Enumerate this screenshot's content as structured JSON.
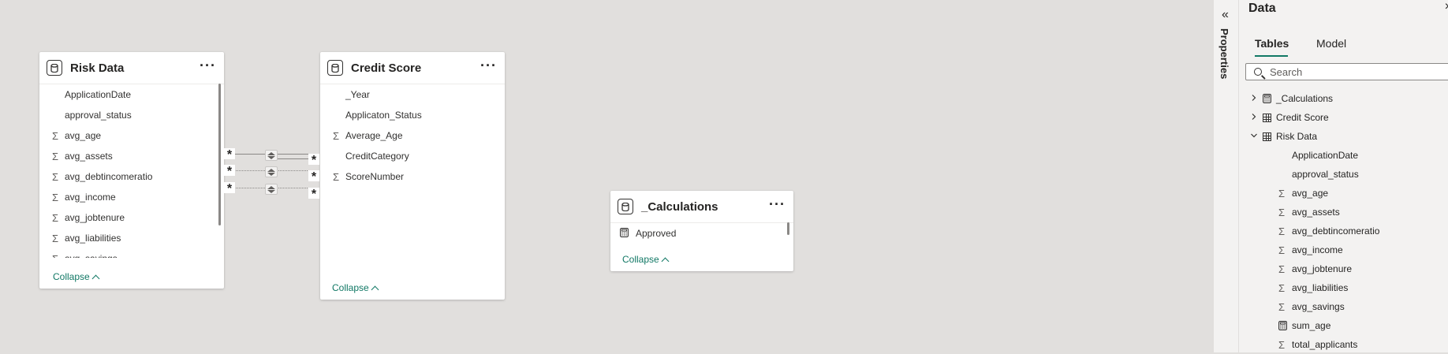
{
  "canvas": {
    "tables": [
      {
        "key": "risk",
        "title": "Risk Data",
        "fields": [
          {
            "label": "ApplicationDate",
            "sigma": false
          },
          {
            "label": "approval_status",
            "sigma": false
          },
          {
            "label": "avg_age",
            "sigma": true
          },
          {
            "label": "avg_assets",
            "sigma": true
          },
          {
            "label": "avg_debtincomeratio",
            "sigma": true
          },
          {
            "label": "avg_income",
            "sigma": true
          },
          {
            "label": "avg_jobtenure",
            "sigma": true
          },
          {
            "label": "avg_liabilities",
            "sigma": true
          },
          {
            "label": "avg_savings",
            "sigma": true
          }
        ],
        "collapse_label": "Collapse"
      },
      {
        "key": "credit",
        "title": "Credit Score",
        "fields": [
          {
            "label": "_Year",
            "sigma": false
          },
          {
            "label": "Applicaton_Status",
            "sigma": false
          },
          {
            "label": "Average_Age",
            "sigma": true
          },
          {
            "label": "CreditCategory",
            "sigma": false
          },
          {
            "label": "ScoreNumber",
            "sigma": true
          }
        ],
        "collapse_label": "Collapse"
      },
      {
        "key": "calc",
        "title": "_Calculations",
        "fields": [
          {
            "label": "Approved",
            "calc": true
          }
        ],
        "collapse_label": "Collapse"
      }
    ],
    "relationship_symbol": "*",
    "more_symbol": "···",
    "sigma_symbol": "Σ"
  },
  "properties_panel": {
    "label": "Properties",
    "expand_icon": "«"
  },
  "data_pane": {
    "title": "Data",
    "close_icon": "×",
    "tabs": [
      "Tables",
      "Model"
    ],
    "active_tab": "Tables",
    "search": {
      "placeholder": "Search",
      "value": ""
    },
    "tree": [
      {
        "label": "_Calculations",
        "icon": "calc",
        "expand": "collapsed",
        "level": 0
      },
      {
        "label": "Credit Score",
        "icon": "table",
        "expand": "collapsed",
        "level": 0
      },
      {
        "label": "Risk Data",
        "icon": "table",
        "expand": "expanded",
        "level": 0
      },
      {
        "label": "ApplicationDate",
        "icon": "none",
        "level": 1
      },
      {
        "label": "approval_status",
        "icon": "none",
        "level": 1
      },
      {
        "label": "avg_age",
        "icon": "sigma",
        "level": 1
      },
      {
        "label": "avg_assets",
        "icon": "sigma",
        "level": 1
      },
      {
        "label": "avg_debtincomeratio",
        "icon": "sigma",
        "level": 1
      },
      {
        "label": "avg_income",
        "icon": "sigma",
        "level": 1
      },
      {
        "label": "avg_jobtenure",
        "icon": "sigma",
        "level": 1
      },
      {
        "label": "avg_liabilities",
        "icon": "sigma",
        "level": 1
      },
      {
        "label": "avg_savings",
        "icon": "sigma",
        "level": 1
      },
      {
        "label": "sum_age",
        "icon": "calc",
        "level": 1
      },
      {
        "label": "total_applicants",
        "icon": "sigma",
        "level": 1
      }
    ]
  },
  "colors": {
    "canvas_bg": "#e1dfdd",
    "accent": "#117865",
    "pane_bg": "#f3f2f1"
  }
}
